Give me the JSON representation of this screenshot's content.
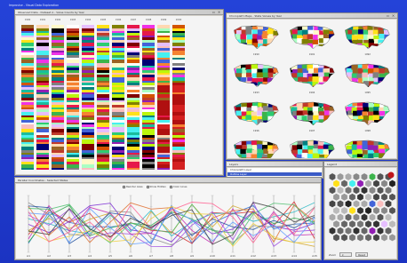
{
  "app": {
    "title": "Improvise - Visual Data Exploration"
  },
  "heatmap_window": {
    "title": "Observed Data - Dataset A - Value Counts by Year",
    "columns": [
      "1990",
      "1991",
      "1992",
      "1993",
      "1994",
      "1995",
      "1996",
      "1997",
      "1998",
      "1999",
      "2000"
    ]
  },
  "maps_window": {
    "title": "Choropleth Maps - State Values by Year",
    "labels": [
      "1990",
      "1991",
      "1992",
      "1993",
      "1994",
      "1995",
      "1996",
      "1997",
      "1998",
      "1999",
      "2000",
      "2001"
    ]
  },
  "layers_window": {
    "title": "Layers",
    "items": [
      "Choropleth Layer",
      "Outline Layer",
      "Labels Layer"
    ]
  },
  "legend_window": {
    "title": "Legend",
    "zoom_label": "Zoom",
    "reset_label": "Reset"
  },
  "parallel_window": {
    "title": "Parallel Coordinates - Selected States",
    "option1_label": "Reorder Axes",
    "option2_label": "Show Hidden",
    "option3_label": "Color Lines",
    "axes": [
      "A1",
      "A2",
      "A3",
      "A4",
      "A5",
      "A6",
      "A7",
      "A8",
      "A9",
      "A10",
      "A11",
      "A12",
      "A13",
      "A14",
      "A15"
    ]
  },
  "colors": {
    "desktop": "#1f3ad0",
    "window_frame": "#d4d0c8",
    "selection": "#3a5bc7"
  }
}
